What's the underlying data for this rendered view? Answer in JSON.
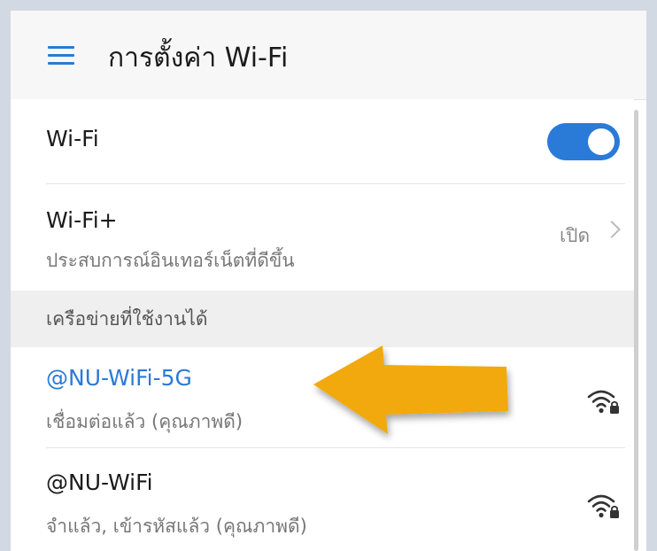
{
  "header": {
    "title": "การตั้งค่า Wi-Fi",
    "menu_icon": "hamburger-menu-icon"
  },
  "wifi_toggle": {
    "label": "Wi-Fi",
    "state": "on",
    "accent": "#2a7ad8"
  },
  "wifi_plus": {
    "label": "Wi-Fi+",
    "subtitle": "ประสบการณ์อินเทอร์เน็ตที่ดีขึ้น",
    "value": "เปิด"
  },
  "networks_section": {
    "title": "เครือข่ายที่ใช้งานได้"
  },
  "networks": [
    {
      "name": "@NU-WiFi-5G",
      "status": "เชื่อมต่อแล้ว (คุณภาพดี)",
      "icon": "wifi-locked-icon",
      "connected": true,
      "name_color": "#2a7ad8"
    },
    {
      "name": "@NU-WiFi",
      "status": "จำแล้ว, เข้ารหัสแล้ว (คุณภาพดี)",
      "icon": "wifi-locked-icon",
      "connected": false,
      "name_color": "#1b1b1b"
    }
  ],
  "annotation": {
    "arrow_color": "#f2a90f"
  }
}
